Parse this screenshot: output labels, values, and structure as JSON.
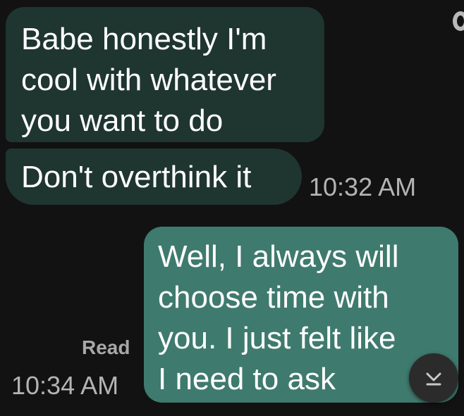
{
  "messages": [
    {
      "direction": "incoming",
      "lines": [
        "Babe honestly I'm",
        "cool with whatever",
        "you want to do"
      ]
    },
    {
      "direction": "incoming",
      "lines": [
        "Don't overthink it"
      ],
      "time": "10:32 AM"
    },
    {
      "direction": "outgoing",
      "lines": [
        "Well, I always will",
        "choose time with",
        "you. I just felt like",
        "I need to ask"
      ],
      "status": "Read",
      "time": "10:34 AM"
    }
  ],
  "colors": {
    "background": "#121212",
    "incoming_bubble": "#1f3530",
    "outgoing_bubble": "#3f7a6e",
    "timestamp": "#b4b4b4"
  },
  "icons": {
    "scroll_button": "chevron-down-to-bar-icon",
    "corner": "partial-icon"
  }
}
